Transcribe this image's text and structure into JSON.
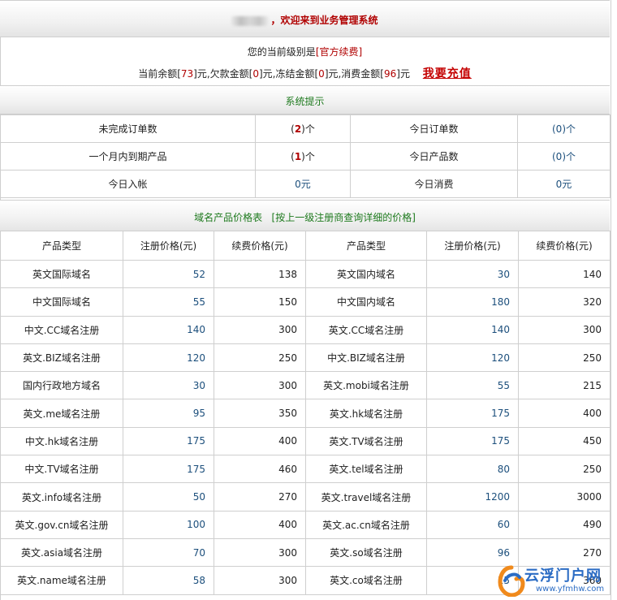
{
  "welcome": {
    "text": "，欢迎来到业务管理系统"
  },
  "account": {
    "level_prefix": "您的当前级别是",
    "level": "[官方续费]",
    "balance_label": "当前余额[",
    "balance": "73",
    "debt_label": "]元,欠款金额[",
    "debt": "0",
    "frozen_label": "]元,冻结金额[",
    "frozen": "0",
    "consumed_label": "]元,消费金额[",
    "consumed": "96",
    "suffix": "]元",
    "recharge_label": "我要充值"
  },
  "system_tips": {
    "title": "系统提示",
    "rows": [
      {
        "label_a": "未完成订单数",
        "value_a": "2",
        "label_b": "今日订单数",
        "value_b": "(0)个"
      },
      {
        "label_a": "一个月内到期产品",
        "value_a": "1",
        "label_b": "今日产品数",
        "value_b": "(0)个"
      },
      {
        "label_a": "今日入帐",
        "value_a": "0元",
        "label_b": "今日消费",
        "value_b": "0元"
      }
    ],
    "count_prefix": "(",
    "count_suffix": ")个"
  },
  "price_table": {
    "title": "域名产品价格表",
    "note": "[按上一级注册商查询详细的价格]",
    "headers": [
      "产品类型",
      "注册价格(元)",
      "续费价格(元)",
      "产品类型",
      "注册价格(元)",
      "续费价格(元)"
    ],
    "rows": [
      [
        "英文国际域名",
        "52",
        "138",
        "英文国内域名",
        "30",
        "140"
      ],
      [
        "中文国际域名",
        "55",
        "150",
        "中文国内域名",
        "180",
        "320"
      ],
      [
        "中文.CC域名注册",
        "140",
        "300",
        "英文.CC域名注册",
        "140",
        "300"
      ],
      [
        "英文.BIZ域名注册",
        "120",
        "250",
        "中文.BIZ域名注册",
        "120",
        "250"
      ],
      [
        "国内行政地方域名",
        "30",
        "300",
        "英文.mobi域名注册",
        "55",
        "215"
      ],
      [
        "英文.me域名注册",
        "95",
        "350",
        "英文.hk域名注册",
        "175",
        "400"
      ],
      [
        "中文.hk域名注册",
        "175",
        "400",
        "英文.TV域名注册",
        "175",
        "450"
      ],
      [
        "中文.TV域名注册",
        "175",
        "460",
        "英文.tel域名注册",
        "80",
        "250"
      ],
      [
        "英文.info域名注册",
        "50",
        "270",
        "英文.travel域名注册",
        "1200",
        "3000"
      ],
      [
        "英文.gov.cn域名注册",
        "100",
        "400",
        "英文.ac.cn域名注册",
        "60",
        "490"
      ],
      [
        "英文.asia域名注册",
        "70",
        "300",
        "英文.so域名注册",
        "96",
        "270"
      ],
      [
        "英文.name域名注册",
        "58",
        "300",
        "英文.co域名注册",
        "15",
        "360"
      ]
    ]
  },
  "watermark": {
    "text": "云浮门户网",
    "url": "www.yfmhw.com"
  }
}
